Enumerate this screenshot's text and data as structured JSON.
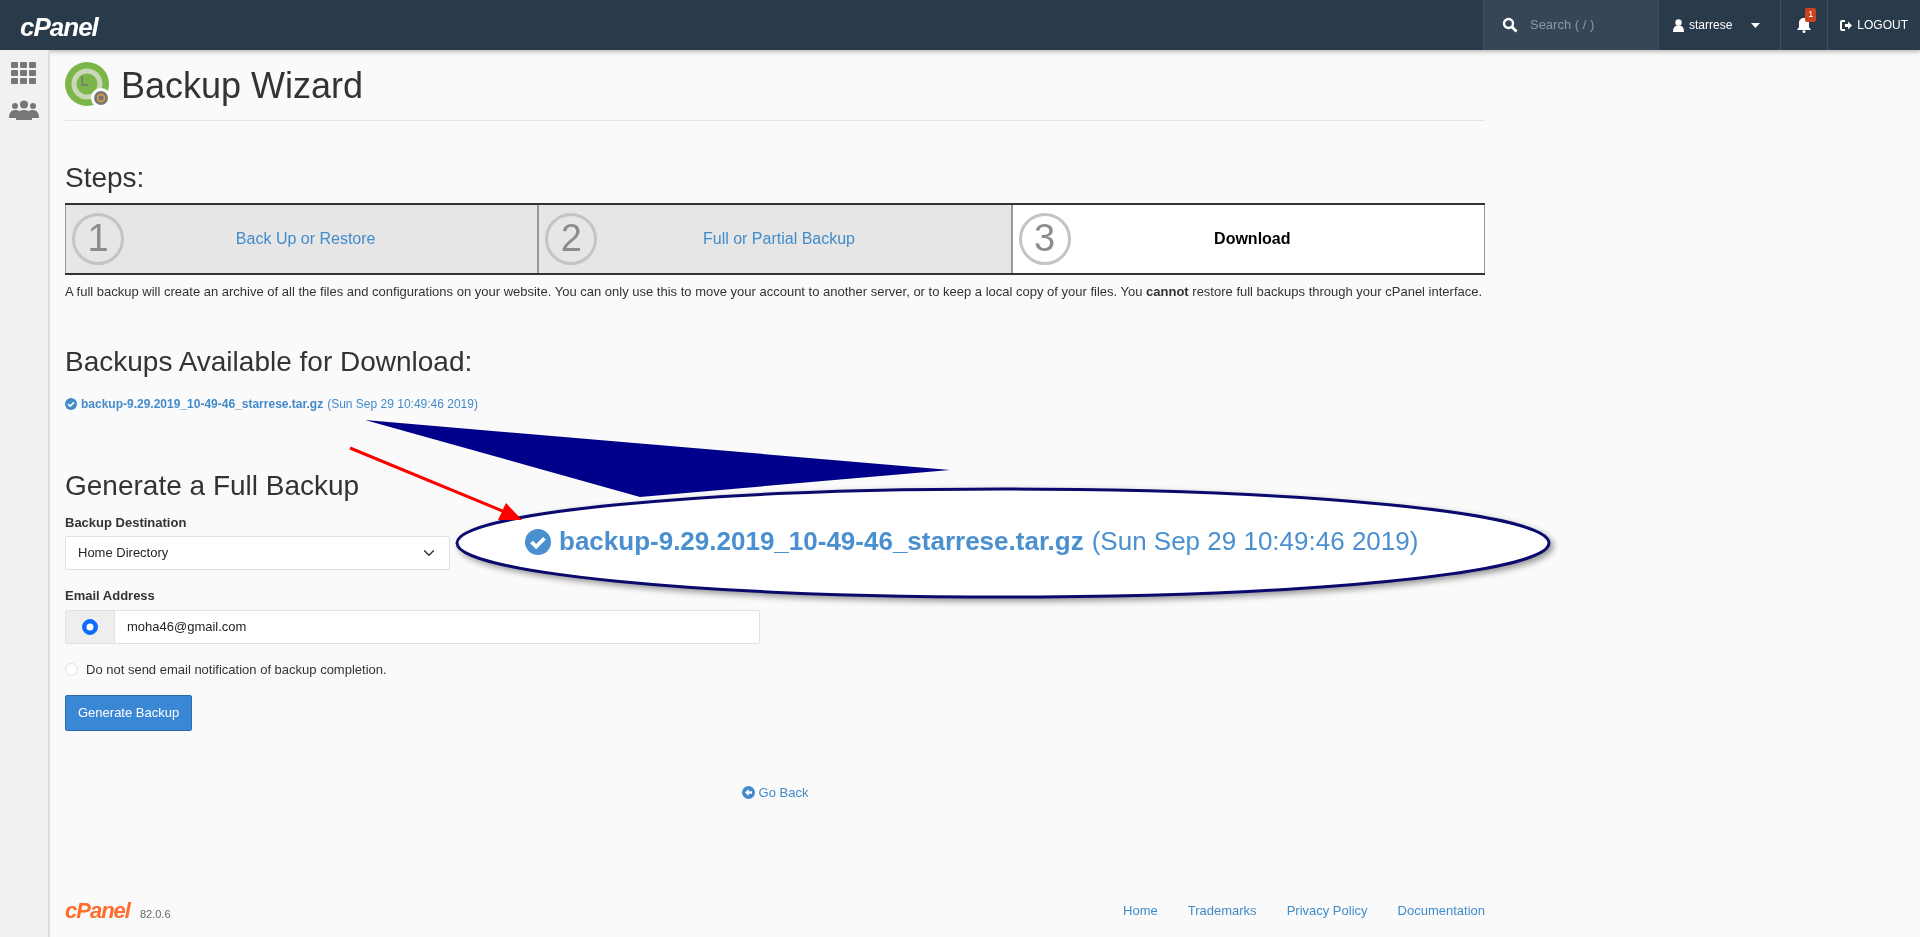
{
  "topbar": {
    "logo": "cPanel",
    "search": {
      "placeholder": "Search ( / )"
    },
    "user": "starrese",
    "notifications": "1",
    "logout": "LOGOUT"
  },
  "page": {
    "title": "Backup Wizard"
  },
  "steps": {
    "heading": "Steps:",
    "items": [
      {
        "number": "1",
        "label": "Back Up or Restore",
        "selected": false
      },
      {
        "number": "2",
        "label": "Full or Partial Backup",
        "selected": false
      },
      {
        "number": "3",
        "label": "Download",
        "selected": true
      }
    ]
  },
  "description": "A full backup will create an archive of all the files and configurations on your website. You can only use this to move your account to another server, or to keep a local copy of your files. You **cannot** restore full backups through your cPanel interface.",
  "backups": {
    "heading": "Backups Available for Download:",
    "items": [
      {
        "file": "backup-9.29.2019_10-49-46_starrese.tar.gz",
        "date": "(Sun Sep 29 10:49:46 2019)"
      }
    ]
  },
  "generate": {
    "heading": "Generate a Full Backup",
    "destination": {
      "label": "Backup Destination",
      "value": "Home Directory"
    },
    "email": {
      "label": "Email Address",
      "value": "moha46@gmail.com",
      "selected": true
    },
    "no_email": {
      "label": "Do not send email notification of backup completion.",
      "selected": false
    },
    "button": "Generate Backup"
  },
  "go_back": "Go Back",
  "footer": {
    "logo": "cPanel",
    "version": "82.0.6",
    "links": [
      "Home",
      "Trademarks",
      "Privacy Policy",
      "Documentation"
    ]
  },
  "callout": {
    "file": "backup-9.29.2019_10-49-46_starrese.tar.gz",
    "date": "(Sun Sep 29 10:49:46 2019)"
  }
}
